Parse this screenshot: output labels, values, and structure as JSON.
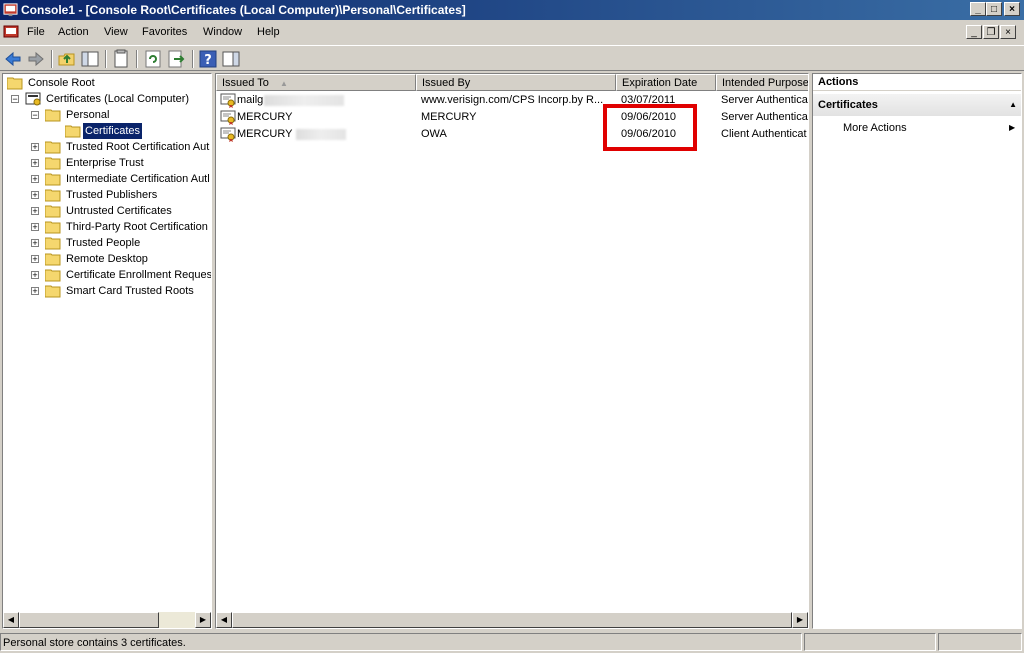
{
  "window": {
    "title": "Console1 - [Console Root\\Certificates (Local Computer)\\Personal\\Certificates]",
    "minimize_glyph": "_",
    "maximize_glyph": "□",
    "close_glyph": "×"
  },
  "menu": [
    "File",
    "Action",
    "View",
    "Favorites",
    "Window",
    "Help"
  ],
  "mdi": {
    "minimize_glyph": "_",
    "restore_glyph": "❐",
    "close_glyph": "×"
  },
  "toolbar": {
    "icons": [
      "back-arrow-icon",
      "forward-arrow-icon",
      "up-folder-icon",
      "show-hide-console-tree-icon",
      "export-list-icon",
      "refresh-icon",
      "export-icon",
      "help-icon",
      "show-hide-action-pane-icon"
    ]
  },
  "tree": {
    "items": [
      {
        "label": "Console Root"
      },
      {
        "label": "Certificates (Local Computer)",
        "expander": "−"
      },
      {
        "label": "Personal",
        "expander": "−"
      },
      {
        "label": "Certificates"
      },
      {
        "label": "Trusted Root Certification Aut",
        "expander": "+"
      },
      {
        "label": "Enterprise Trust",
        "expander": "+"
      },
      {
        "label": "Intermediate Certification Autl",
        "expander": "+"
      },
      {
        "label": "Trusted Publishers",
        "expander": "+"
      },
      {
        "label": "Untrusted Certificates",
        "expander": "+"
      },
      {
        "label": "Third-Party Root Certification",
        "expander": "+"
      },
      {
        "label": "Trusted People",
        "expander": "+"
      },
      {
        "label": "Remote Desktop",
        "expander": "+"
      },
      {
        "label": "Certificate Enrollment Request",
        "expander": "+"
      },
      {
        "label": "Smart Card Trusted Roots",
        "expander": "+"
      }
    ]
  },
  "list": {
    "columns": [
      "Issued To",
      "Issued By",
      "Expiration Date",
      "Intended Purpose"
    ],
    "sort_glyph": "▲",
    "rows": [
      {
        "issued_to": "mailg",
        "issued_by": "www.verisign.com/CPS Incorp.by R...",
        "expiration": "03/07/2011",
        "purpose": "Server Authentica"
      },
      {
        "issued_to": "MERCURY",
        "issued_by": "MERCURY",
        "expiration": "09/06/2010",
        "purpose": "Server Authentica"
      },
      {
        "issued_to": "MERCURY",
        "issued_by": "OWA",
        "expiration": "09/06/2010",
        "purpose": "Client Authenticat"
      }
    ]
  },
  "scroll": {
    "left_glyph": "◀",
    "right_glyph": "▶"
  },
  "actions": {
    "title": "Actions",
    "section": "Certificates",
    "section_glyph": "▲",
    "items": [
      "More Actions"
    ],
    "item_glyph": "▶"
  },
  "status": {
    "text": "Personal store contains 3 certificates."
  },
  "colors": {
    "titlebar": "#0a246a",
    "selection": "#0a246a",
    "highlight": "#e00000",
    "chrome": "#d4d0c8"
  }
}
